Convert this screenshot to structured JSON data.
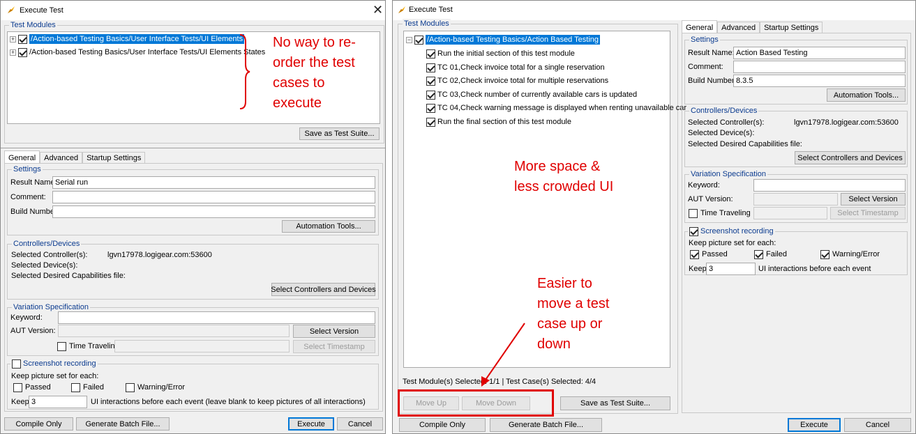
{
  "left": {
    "title": "Execute Test",
    "test_modules_label": "Test Modules",
    "modules": [
      "/Action-based Testing Basics/User Interface Tests/UI Elements",
      "/Action-based Testing Basics/User Interface Tests/UI Elements States"
    ],
    "save_suite": "Save as Test Suite...",
    "tabs": [
      "General",
      "Advanced",
      "Startup Settings"
    ],
    "settings": {
      "group": "Settings",
      "result_name_label": "Result Name:",
      "result_name_value": "Serial run",
      "comment_label": "Comment:",
      "build_label": "Build Number:",
      "automation_tools": "Automation Tools..."
    },
    "controllers": {
      "group": "Controllers/Devices",
      "controller_label": "Selected Controller(s):",
      "controller_value": "lgvn17978.logigear.com:53600",
      "device_label": "Selected Device(s):",
      "caps_label": "Selected Desired Capabilities file:",
      "select_button": "Select Controllers and Devices"
    },
    "variation": {
      "group": "Variation Specification",
      "keyword_label": "Keyword:",
      "aut_label": "AUT Version:",
      "select_version": "Select Version",
      "time_traveling": "Time Traveling",
      "select_timestamp": "Select Timestamp"
    },
    "screenshot": {
      "group": "Screenshot recording",
      "keep_set": "Keep picture set for each:",
      "passed": "Passed",
      "failed": "Failed",
      "warning": "Warning/Error",
      "keep_label": "Keep",
      "keep_value": "3",
      "keep_suffix": "UI interactions before each event (leave blank to keep pictures of all interactions)"
    },
    "buttons": {
      "compile": "Compile Only",
      "batch": "Generate Batch File...",
      "execute": "Execute",
      "cancel": "Cancel"
    }
  },
  "right": {
    "title": "Execute Test",
    "test_modules_label": "Test Modules",
    "root": "/Action-based Testing Basics/Action Based Testing",
    "items": [
      "Run the initial section of this test module",
      "TC 01,Check invoice total for a single reservation",
      "TC 02,Check invoice total for multiple reservations",
      "TC 03,Check number of currently available cars is updated",
      "TC 04,Check warning message is displayed when renting unavailable car",
      "Run the final section of this test module"
    ],
    "status": "Test Module(s) Selected: 1/1 | Test Case(s) Selected: 4/4",
    "move_up": "Move Up",
    "move_down": "Move Down",
    "save_suite": "Save as Test Suite...",
    "tabs": [
      "General",
      "Advanced",
      "Startup Settings"
    ],
    "settings": {
      "group": "Settings",
      "result_name_label": "Result Name:",
      "result_name_value": "Action Based Testing",
      "comment_label": "Comment:",
      "build_label": "Build Number:",
      "build_value": "8.3.5",
      "automation_tools": "Automation Tools..."
    },
    "controllers": {
      "group": "Controllers/Devices",
      "controller_label": "Selected Controller(s):",
      "controller_value": "lgvn17978.logigear.com:53600",
      "device_label": "Selected Device(s):",
      "caps_label": "Selected Desired Capabilities file:",
      "select_button": "Select Controllers and Devices"
    },
    "variation": {
      "group": "Variation Specification",
      "keyword_label": "Keyword:",
      "aut_label": "AUT Version:",
      "select_version": "Select Version",
      "time_traveling": "Time Traveling",
      "select_timestamp": "Select Timestamp"
    },
    "screenshot": {
      "group": "Screenshot recording",
      "keep_set": "Keep picture set for each:",
      "passed": "Passed",
      "failed": "Failed",
      "warning": "Warning/Error",
      "keep_label": "Keep",
      "keep_value": "3",
      "keep_suffix": "UI interactions before each event"
    },
    "buttons": {
      "compile": "Compile Only",
      "batch": "Generate Batch File...",
      "execute": "Execute",
      "cancel": "Cancel"
    }
  },
  "annotations": {
    "left_lines": [
      "No way to re-",
      "order the test",
      "cases to",
      "execute"
    ],
    "space_lines": [
      "More space &",
      "less crowded UI"
    ],
    "move_lines": [
      "Easier to",
      "move a test",
      "case up or",
      "down"
    ]
  },
  "colors": {
    "annotation": "#e00000",
    "selection": "#0078d7",
    "group_title": "#0b3b8f"
  }
}
